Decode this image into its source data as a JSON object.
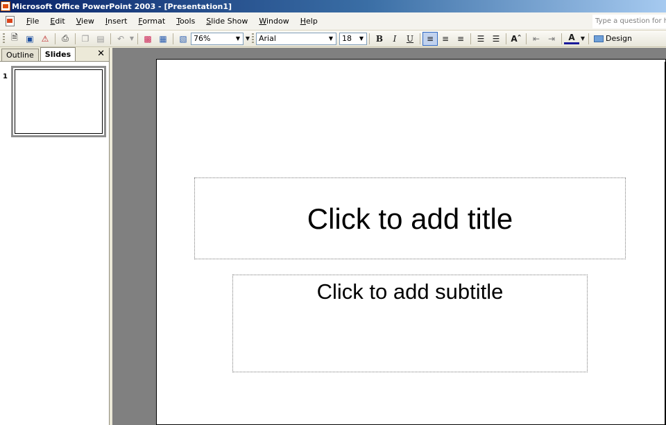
{
  "window": {
    "title": "Microsoft Office PowerPoint 2003 - [Presentation1]"
  },
  "menu": {
    "items": [
      "File",
      "Edit",
      "View",
      "Insert",
      "Format",
      "Tools",
      "Slide Show",
      "Window",
      "Help"
    ],
    "help_placeholder": "Type a question for h"
  },
  "toolbar": {
    "zoom": "76%",
    "font": "Arial",
    "font_size": "18",
    "bold": "B",
    "italic": "I",
    "underline": "U",
    "design_label": "Design",
    "align_left_active": true
  },
  "left_pane": {
    "tabs": [
      "Outline",
      "Slides"
    ],
    "selected_tab": "Slides",
    "close": "✕",
    "slide_number": "1"
  },
  "slide": {
    "title_placeholder": "Click to add title",
    "subtitle_placeholder": "Click to add subtitle"
  }
}
